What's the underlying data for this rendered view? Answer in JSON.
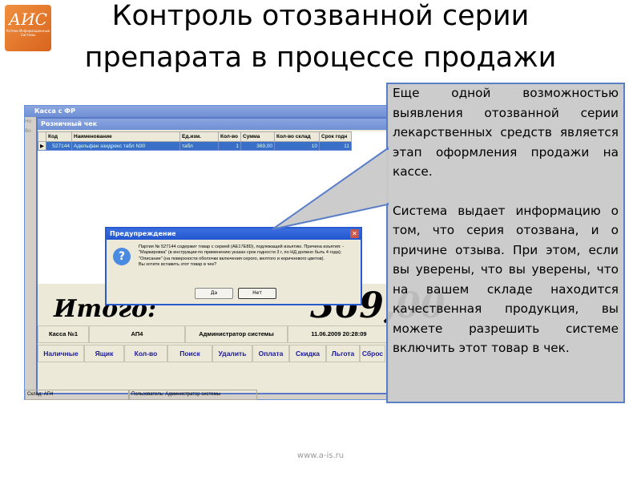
{
  "slide": {
    "title": "Контроль отозванной серии препарата в процессе продажи",
    "logo_text": "АИС",
    "logo_sub": "Аптеки Информационные Системы",
    "footer": "www.a-is.ru"
  },
  "app": {
    "window_title": "Касса с ФР",
    "menu": [
      "Но",
      "Во"
    ],
    "subwindow_title": "Розничный чек",
    "columns": [
      "Код",
      "Наименование",
      "Ед.изм.",
      "Кол-во",
      "Сумма",
      "Кол-во склад",
      "Срок годн"
    ],
    "rows": [
      [
        "527144",
        "Адельфан эзидрекс табл N30",
        "табл",
        "1",
        "369,00",
        "10",
        "11"
      ]
    ],
    "total_label": "Итого:",
    "total_value": "369,00",
    "info": [
      "Касса №1",
      "АП4",
      "Администратор системы",
      "11.06.2009 20:28:09"
    ],
    "buttons": [
      "Наличные",
      "Ящик",
      "Кол-во",
      "Поиск",
      "Удалить",
      "Оплата",
      "Скидка",
      "Льгота",
      "Сброс"
    ],
    "status": [
      "Склад: АП4",
      "Пользователь: Администратор системы"
    ]
  },
  "dialog": {
    "title": "Предупреждение",
    "message": "Партия № 527144 содержит товар с серией (AE17E8D), подлежащей изъятию. Причина изъятия: -\"Маркировка\" (в инструкции по применению указан срок годности 3 г, по НД должно быть 4 года); \"Описание\" (на поверхности оболочки включения серого, желтого и коричневого цветов).",
    "question": "Вы хотите вставить этот товар в чек?",
    "yes": "Да",
    "no": "Нет"
  },
  "callout": {
    "p1": "Еще одной возможностью выявления отозванной серии лекарственных средств является этап оформления продажи на кассе.",
    "p2": "Система выдает информацию о том, что серия отозвана, и о причине отзыва. При этом, если вы уверены, что вы уверены, что на вашем складе находится качественная продукция, вы можете разрешить системе включить этот товар в чек."
  },
  "colors": {
    "callout_border": "#5a7ec8",
    "titlebar": "#2456d0",
    "logo": "#e07a2c"
  }
}
